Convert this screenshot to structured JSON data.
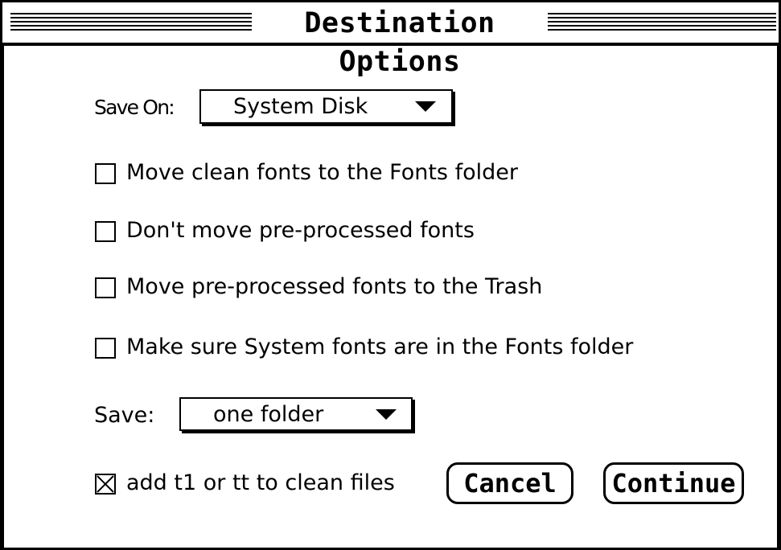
{
  "window": {
    "title": "Destination Options"
  },
  "save_on": {
    "label": "Save On:",
    "selected": "System Disk"
  },
  "options": [
    {
      "label": "Move clean fonts to the Fonts folder",
      "checked": false
    },
    {
      "label": "Don't move pre-processed fonts",
      "checked": false
    },
    {
      "label": "Move pre-processed fonts to the Trash",
      "checked": false
    },
    {
      "label": "Make sure System fonts are in the Fonts folder",
      "checked": false
    }
  ],
  "save": {
    "label": "Save:",
    "selected": "one folder"
  },
  "add_suffix": {
    "label": "add t1 or tt to clean files",
    "checked": true
  },
  "buttons": {
    "cancel": "Cancel",
    "continue": "Continue"
  }
}
